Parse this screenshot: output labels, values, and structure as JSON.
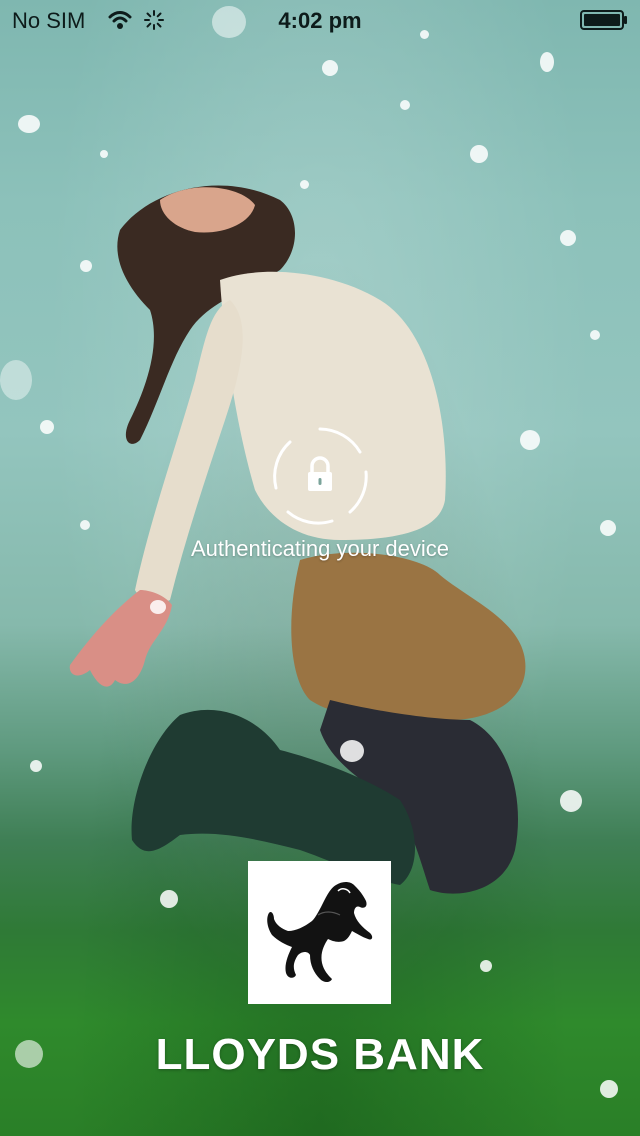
{
  "status_bar": {
    "carrier": "No SIM",
    "time": "4:02 pm",
    "icons": [
      "wifi-icon",
      "activity-spinner-icon",
      "battery-icon"
    ]
  },
  "auth": {
    "message": "Authenticating your device",
    "icon": "padlock-icon"
  },
  "brand": {
    "name": "LLOYDS BANK",
    "logo_icon": "black-horse-icon",
    "colors": {
      "logo_background": "#ffffff",
      "logo_horse": "#111111",
      "text": "#ffffff"
    }
  }
}
